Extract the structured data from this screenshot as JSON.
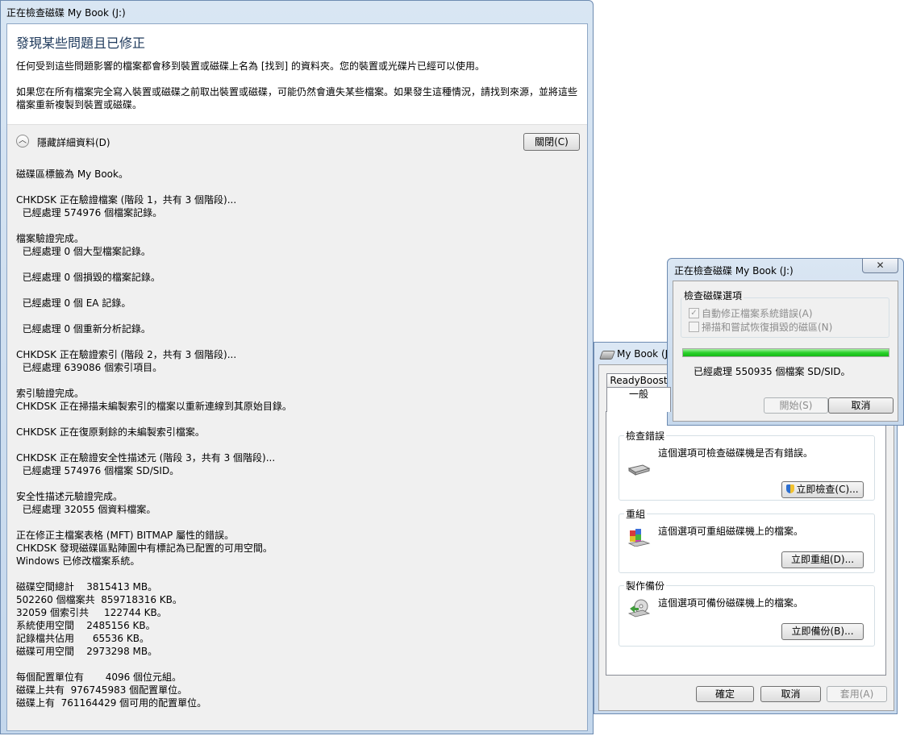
{
  "main_window": {
    "title": "正在檢查磁碟 My Book (J:)",
    "heading": "發現某些問題且已修正",
    "para1": "任何受到這些問題影響的檔案都會移到裝置或磁碟上名為 [找到] 的資料夾。您的裝置或光碟片已經可以使用。",
    "para2_line1": "如果您在所有檔案完全寫入裝置或磁碟之前取出裝置或磁碟，可能仍然會遺失某些檔案。如果發生這種情況，請找到來源，並將這些",
    "para2_line2": "檔案重新複製到裝置或磁碟。",
    "hide_details_label": "隱藏詳細資料(D)",
    "close_button": "關閉(C)",
    "log_lines": [
      "磁碟區標籤為 My Book。",
      "",
      "CHKDSK 正在驗證檔案 (階段 1，共有 3 個階段)...",
      "  已經處理 574976 個檔案記錄。",
      "",
      "檔案驗證完成。",
      "  已經處理 0 個大型檔案記錄。",
      "",
      "  已經處理 0 個損毀的檔案記錄。",
      "",
      "  已經處理 0 個 EA 記錄。",
      "",
      "  已經處理 0 個重新分析記錄。",
      "",
      "CHKDSK 正在驗證索引 (階段 2，共有 3 個階段)...",
      "  已經處理 639086 個索引項目。",
      "",
      "索引驗證完成。",
      "CHKDSK 正在掃描未編製索引的檔案以重新連線到其原始目錄。",
      "",
      "CHKDSK 正在復原剩餘的未編製索引檔案。",
      "",
      "CHKDSK 正在驗證安全性描述元 (階段 3，共有 3 個階段)...",
      "  已經處理 574976 個檔案 SD/SID。",
      "",
      "安全性描述元驗證完成。",
      "  已經處理 32055 個資料檔案。",
      "",
      "正在修正主檔案表格 (MFT) BITMAP 屬性的錯誤。",
      "CHKDSK 發現磁碟區點陣圖中有標記為已配置的可用空間。",
      "Windows 已修改檔案系統。",
      "",
      "磁碟空間總計    3815413 MB。",
      "502260 個檔案共  859718316 KB。",
      "32059 個索引共     122744 KB。",
      "系統使用空間    2485156 KB。",
      "記錄檔共佔用      65536 KB。",
      "磁碟可用空間    2973298 MB。",
      "",
      "每個配置單位有       4096 個位元組。",
      "磁碟上共有  976745983 個配置單位。",
      "磁碟上有  761164429 個可用的配置單位。"
    ]
  },
  "properties_window": {
    "title": "My Book (J:",
    "tabs": [
      "ReadyBoost",
      "一般"
    ],
    "groups": [
      {
        "title": "檢查錯誤",
        "desc": "這個選項可檢查磁碟機是否有錯誤。",
        "button": "立即檢查(C)...",
        "icon": "drive-icon"
      },
      {
        "title": "重組",
        "desc": "這個選項可重組磁碟機上的檔案。",
        "button": "立即重組(D)...",
        "icon": "defrag-icon"
      },
      {
        "title": "製作備份",
        "desc": "這個選項可備份磁碟機上的檔案。",
        "button": "立即備份(B)...",
        "icon": "backup-icon"
      }
    ],
    "ok_button": "確定",
    "cancel_button": "取消",
    "apply_button": "套用(A)"
  },
  "progress_dialog": {
    "title": "正在檢查磁碟 My Book (J:)",
    "close_glyph": "✕",
    "options_title": "檢查磁碟選項",
    "option1": "自動修正檔案系統錯誤(A)",
    "option1_checked": true,
    "option2": "掃描和嘗試恢復損毀的磁區(N)",
    "option2_checked": false,
    "progress_fraction": 1.0,
    "status": "已經處理 550935 個檔案 SD/SID。",
    "start_button": "開始(S)",
    "cancel_button": "取消"
  }
}
